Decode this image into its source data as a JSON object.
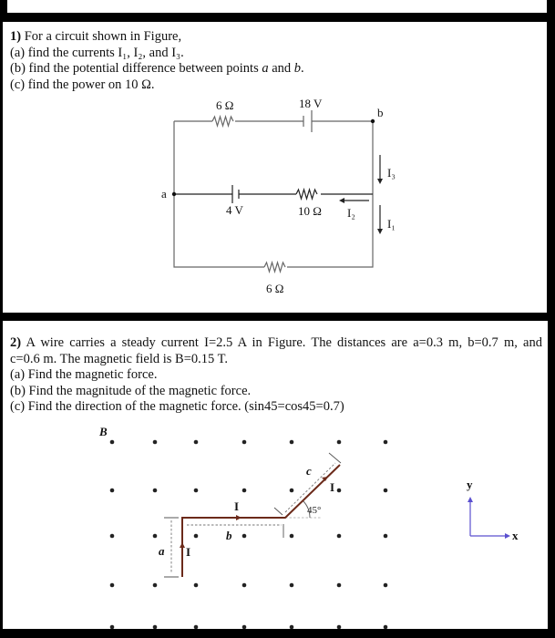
{
  "problem1": {
    "number": "1)",
    "intro": " For a circuit shown in Figure,",
    "a": "(a) find the currents I₁, I₂, and I₃.",
    "b_pre": "(b) find the potential difference between points ",
    "b_a": "a",
    "b_and": " and ",
    "b_b": "b",
    "b_end": ".",
    "c": "(c) find the power on 10 Ω.",
    "circuit": {
      "r_top": "6 Ω",
      "v_top": "18 V",
      "v_mid": "4 V",
      "r_mid": "10 Ω",
      "r_bottom": "6 Ω",
      "node_a": "a",
      "node_b": "b",
      "i1": "I₁",
      "i2": "I₂",
      "i3": "I₃"
    }
  },
  "problem2": {
    "number": "2)",
    "line1": " A wire carries a steady current I=2.5 A in Figure. The distances are a=0.3 m, b=0.7 m, and",
    "line2": "c=0.6 m. The magnetic field is B=0.15 T.",
    "a": "(a) Find the magnetic force.",
    "b": "(b) Find the magnitude of the magnetic force.",
    "c": "(c)  Find the direction of the magnetic force. (sin45=cos45=0.7)",
    "figure": {
      "field_label": "B",
      "current_label": "I",
      "dist_a": "a",
      "dist_b": "b",
      "dist_c": "c",
      "angle": "45°",
      "axis_x": "x",
      "axis_y": "y",
      "wire_color": "#6b2a1a",
      "axis_color": "#5a4fcf"
    }
  }
}
